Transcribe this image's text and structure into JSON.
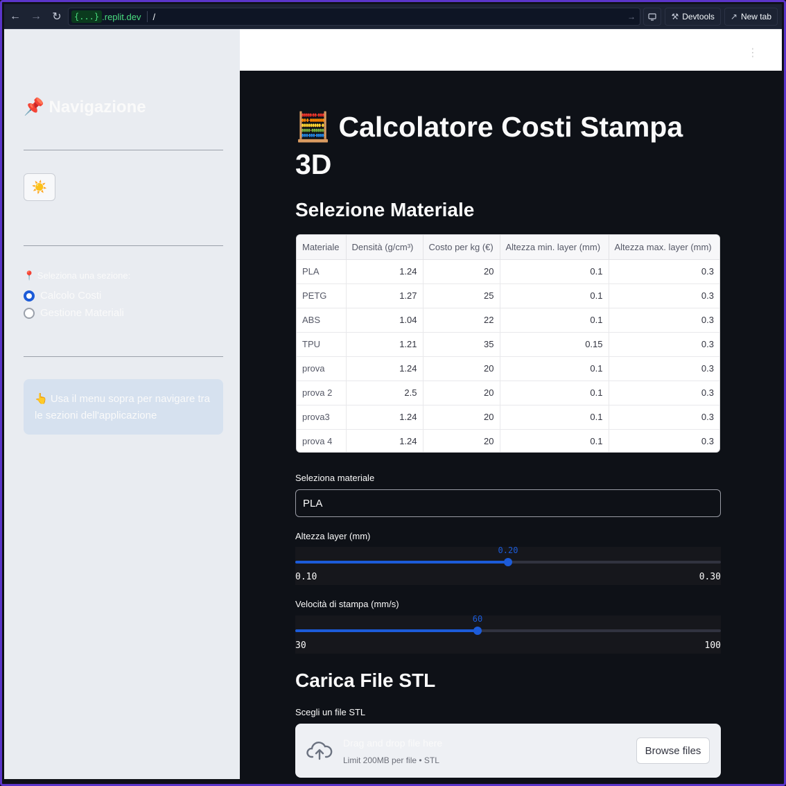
{
  "browser": {
    "url_tag": "{...}",
    "url_domain": ".replit.dev",
    "url_path": "/",
    "devtools_label": "Devtools",
    "newtab_label": "New tab"
  },
  "sidebar": {
    "title": "📌 Navigazione",
    "theme_toggle": "☀️",
    "radio_label": "📍 Seleziona una sezione:",
    "options": [
      "Calcolo Costi",
      "Gestione Materiali"
    ],
    "selected": "Calcolo Costi",
    "info_text": "👆 Usa il menu sopra per navigare tra le sezioni dell'applicazione"
  },
  "main": {
    "title": "🧮 Calcolatore Costi Stampa 3D",
    "section_material": "Selezione Materiale",
    "table": {
      "columns": [
        "Materiale",
        "Densità (g/cm³)",
        "Costo per kg (€)",
        "Altezza min. layer (mm)",
        "Altezza max. layer (mm)"
      ],
      "rows": [
        [
          "PLA",
          "1.24",
          "20",
          "0.1",
          "0.3"
        ],
        [
          "PETG",
          "1.27",
          "25",
          "0.1",
          "0.3"
        ],
        [
          "ABS",
          "1.04",
          "22",
          "0.1",
          "0.3"
        ],
        [
          "TPU",
          "1.21",
          "35",
          "0.15",
          "0.3"
        ],
        [
          "prova",
          "1.24",
          "20",
          "0.1",
          "0.3"
        ],
        [
          "prova 2",
          "2.5",
          "20",
          "0.1",
          "0.3"
        ],
        [
          "prova3",
          "1.24",
          "20",
          "0.1",
          "0.3"
        ],
        [
          "prova 4",
          "1.24",
          "20",
          "0.1",
          "0.3"
        ]
      ]
    },
    "select_label": "Seleziona materiale",
    "select_value": "PLA",
    "layer_slider": {
      "label": "Altezza layer (mm)",
      "min": 0.1,
      "max": 0.3,
      "value": 0.2,
      "min_text": "0.10",
      "max_text": "0.30",
      "value_text": "0.20"
    },
    "speed_slider": {
      "label": "Velocità di stampa (mm/s)",
      "min": 30,
      "max": 100,
      "value": 60,
      "min_text": "30",
      "max_text": "100",
      "value_text": "60"
    },
    "section_stl": "Carica File STL",
    "uploader_label": "Scegli un file STL",
    "uploader_title": "Drag and drop file here",
    "uploader_sub": "Limit 200MB per file • STL",
    "browse_label": "Browse files",
    "accent_color": "#1c5bd8"
  }
}
